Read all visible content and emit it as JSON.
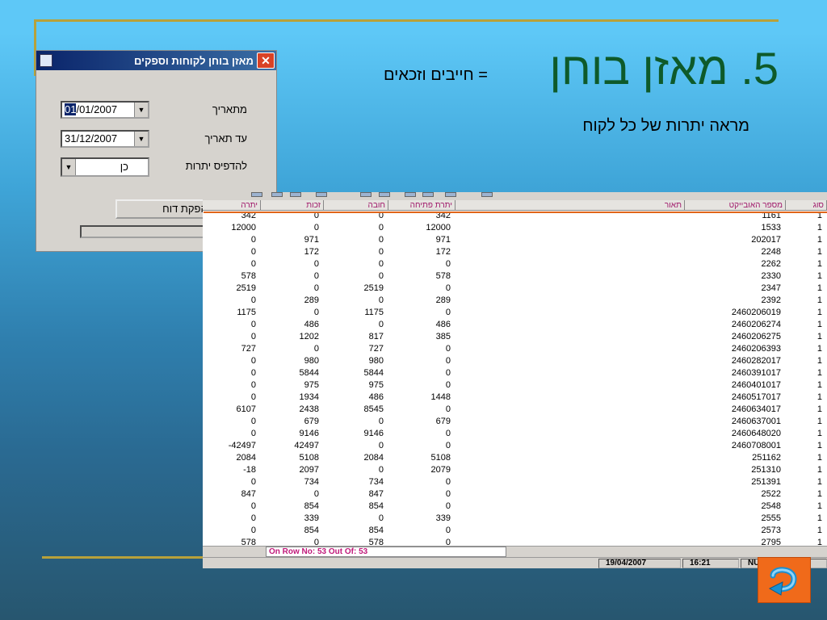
{
  "slide": {
    "title": "5. מאזן בוחן",
    "title_suffix": "= חייבים וזכאים",
    "subtitle": "מראה יתרות של כל לקוח"
  },
  "dialog": {
    "title": "מאזן בוחן לקוחות וספקים",
    "from_label": "מתאריך",
    "from_value_sel": "01",
    "from_value_rest": "/01/2007",
    "to_label": "עד תאריך",
    "to_value": "31/12/2007",
    "print_label": "להדפיס יתרות",
    "print_value": "כן",
    "start_button": "התחל הפקת דוח"
  },
  "grid": {
    "headers": [
      "סוג",
      "מספר האובייקט",
      "תאור",
      "יתרת פתיחה",
      "חובה",
      "זכות",
      "יתרה"
    ],
    "rows": [
      [
        "1",
        "1161",
        "342",
        "0",
        "0",
        "342"
      ],
      [
        "1",
        "1533",
        "12000",
        "0",
        "0",
        "12000"
      ],
      [
        "1",
        "202017",
        "971",
        "0",
        "971",
        "0"
      ],
      [
        "1",
        "2248",
        "172",
        "0",
        "172",
        "0"
      ],
      [
        "1",
        "2262",
        "0",
        "0",
        "0",
        "0"
      ],
      [
        "1",
        "2330",
        "578",
        "0",
        "0",
        "578"
      ],
      [
        "1",
        "2347",
        "0",
        "2519",
        "0",
        "2519"
      ],
      [
        "1",
        "2392",
        "289",
        "0",
        "289",
        "0"
      ],
      [
        "1",
        "2460206019",
        "0",
        "1175",
        "0",
        "1175"
      ],
      [
        "1",
        "2460206274",
        "486",
        "0",
        "486",
        "0"
      ],
      [
        "1",
        "2460206275",
        "385",
        "817",
        "1202",
        "0"
      ],
      [
        "1",
        "2460206393",
        "0",
        "727",
        "0",
        "727"
      ],
      [
        "1",
        "2460282017",
        "0",
        "980",
        "980",
        "0"
      ],
      [
        "1",
        "2460391017",
        "0",
        "5844",
        "5844",
        "0"
      ],
      [
        "1",
        "2460401017",
        "0",
        "975",
        "975",
        "0"
      ],
      [
        "1",
        "2460517017",
        "1448",
        "486",
        "1934",
        "0"
      ],
      [
        "1",
        "2460634017",
        "0",
        "8545",
        "2438",
        "6107"
      ],
      [
        "1",
        "2460637001",
        "679",
        "0",
        "679",
        "0"
      ],
      [
        "1",
        "2460648020",
        "0",
        "9146",
        "9146",
        "0"
      ],
      [
        "1",
        "2460708001",
        "0",
        "0",
        "42497",
        "-42497"
      ],
      [
        "1",
        "251162",
        "5108",
        "2084",
        "5108",
        "2084"
      ],
      [
        "1",
        "251310",
        "2079",
        "0",
        "2097",
        "-18"
      ],
      [
        "1",
        "251391",
        "0",
        "734",
        "734",
        "0"
      ],
      [
        "1",
        "2522",
        "0",
        "847",
        "0",
        "847"
      ],
      [
        "1",
        "2548",
        "0",
        "854",
        "854",
        "0"
      ],
      [
        "1",
        "2555",
        "339",
        "0",
        "339",
        "0"
      ],
      [
        "1",
        "2573",
        "0",
        "854",
        "854",
        "0"
      ],
      [
        "1",
        "2795",
        "0",
        "578",
        "0",
        "578"
      ]
    ],
    "row_status": "On Row No: 53 Out Of:  53",
    "status_date": "19/04/2007",
    "status_time": "16:21",
    "status_num": "NUM"
  },
  "icons": {
    "nav": "return-arrow-icon"
  }
}
